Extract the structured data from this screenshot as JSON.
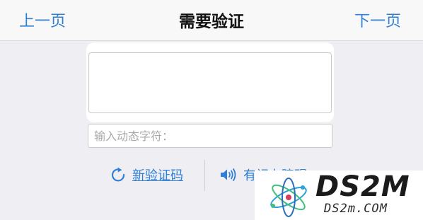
{
  "nav": {
    "prev_label": "上一页",
    "title": "需要验证",
    "next_label": "下一页"
  },
  "captcha": {
    "input_value": "",
    "input_placeholder": "输入动态字符："
  },
  "actions": {
    "refresh_label": "新验证码",
    "refresh_icon": "refresh-icon",
    "audio_label": "有视力障碍",
    "audio_icon": "speaker-icon"
  },
  "watermark": {
    "title": "DS2M",
    "subtitle": "DS2m.COM"
  },
  "colors": {
    "accent": "#2f7fd6",
    "background": "#eeeef3",
    "nav_background": "#f8f8f8",
    "border": "#c9c9c9"
  }
}
